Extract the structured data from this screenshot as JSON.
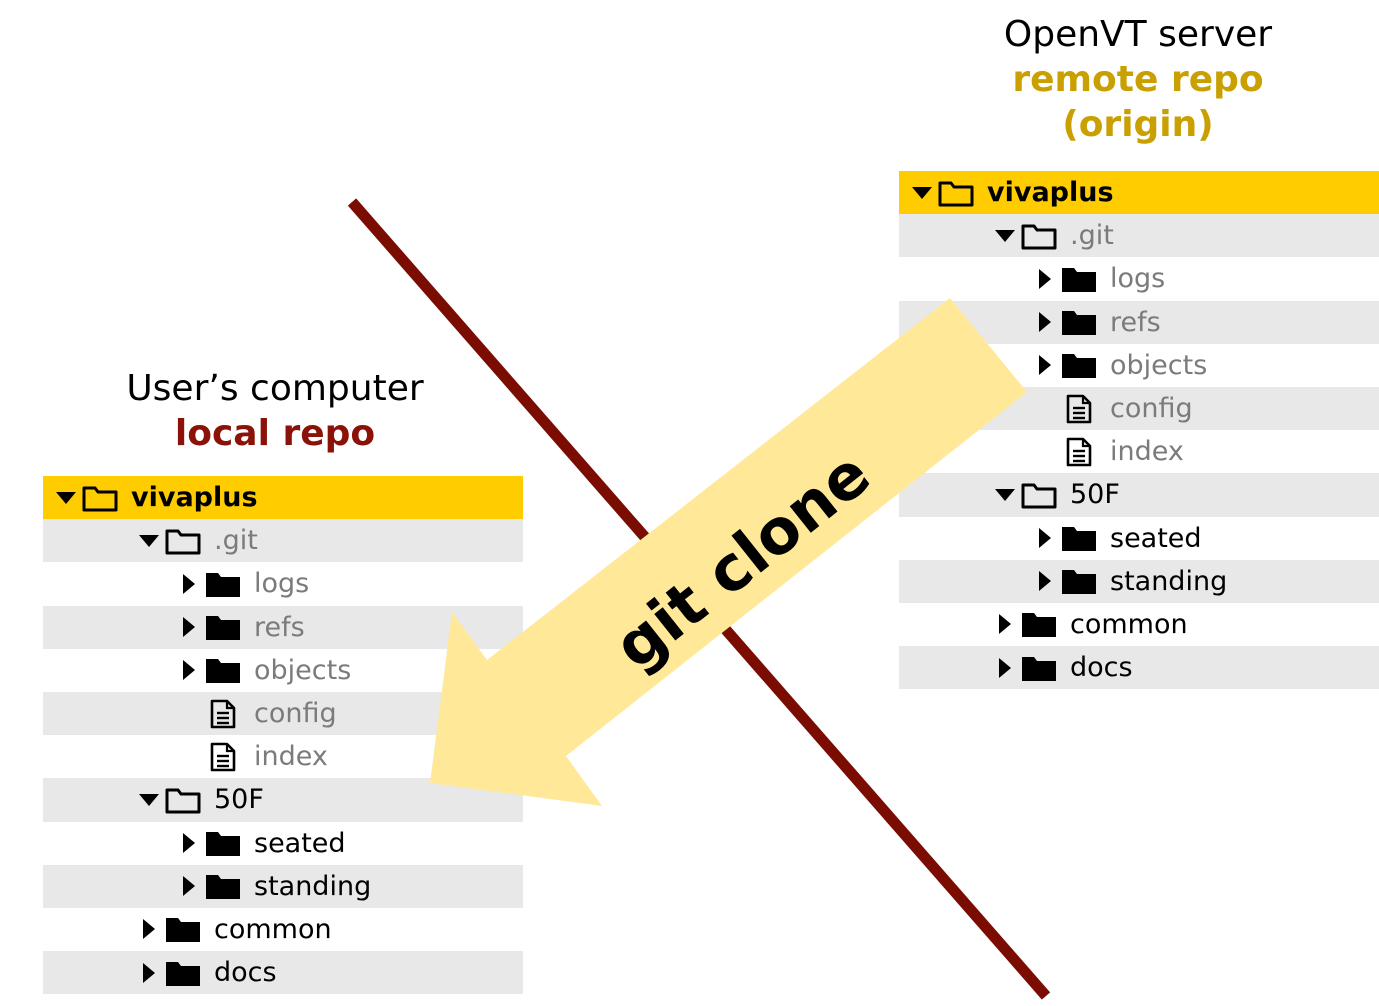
{
  "local": {
    "heading": "User’s computer",
    "subheading": "local repo",
    "subheading_color": "#8b1208",
    "tree": [
      {
        "label": "vivaplus",
        "depth": 0,
        "caret": "down",
        "icon": "folder-open-icon",
        "root": true
      },
      {
        "label": ".git",
        "depth": 1,
        "caret": "down",
        "icon": "folder-open-icon",
        "grey": true
      },
      {
        "label": "logs",
        "depth": 2,
        "caret": "right",
        "icon": "folder-icon",
        "grey": true
      },
      {
        "label": "refs",
        "depth": 2,
        "caret": "right",
        "icon": "folder-icon",
        "grey": true
      },
      {
        "label": "objects",
        "depth": 2,
        "caret": "right",
        "icon": "folder-icon",
        "grey": true
      },
      {
        "label": "config",
        "depth": 2,
        "caret": "none",
        "icon": "file-icon",
        "grey": true
      },
      {
        "label": "index",
        "depth": 2,
        "caret": "none",
        "icon": "file-icon",
        "grey": true
      },
      {
        "label": "50F",
        "depth": 1,
        "caret": "down",
        "icon": "folder-open-icon"
      },
      {
        "label": "seated",
        "depth": 2,
        "caret": "right",
        "icon": "folder-icon"
      },
      {
        "label": "standing",
        "depth": 2,
        "caret": "right",
        "icon": "folder-icon"
      },
      {
        "label": "common",
        "depth": 1,
        "caret": "right",
        "icon": "folder-icon"
      },
      {
        "label": "docs",
        "depth": 1,
        "caret": "right",
        "icon": "folder-icon"
      }
    ]
  },
  "remote": {
    "heading": "OpenVT server",
    "subheading": "remote repo",
    "subheading2": "(origin)",
    "subheading_color": "#c9a000",
    "tree": [
      {
        "label": "vivaplus",
        "depth": 0,
        "caret": "down",
        "icon": "folder-open-icon",
        "root": true
      },
      {
        "label": ".git",
        "depth": 1,
        "caret": "down",
        "icon": "folder-open-icon",
        "grey": true
      },
      {
        "label": "logs",
        "depth": 2,
        "caret": "right",
        "icon": "folder-icon",
        "grey": true
      },
      {
        "label": "refs",
        "depth": 2,
        "caret": "right",
        "icon": "folder-icon",
        "grey": true
      },
      {
        "label": "objects",
        "depth": 2,
        "caret": "right",
        "icon": "folder-icon",
        "grey": true
      },
      {
        "label": "config",
        "depth": 2,
        "caret": "none",
        "icon": "file-icon",
        "grey": true
      },
      {
        "label": "index",
        "depth": 2,
        "caret": "none",
        "icon": "file-icon",
        "grey": true
      },
      {
        "label": "50F",
        "depth": 1,
        "caret": "down",
        "icon": "folder-open-icon"
      },
      {
        "label": "seated",
        "depth": 2,
        "caret": "right",
        "icon": "folder-icon"
      },
      {
        "label": "standing",
        "depth": 2,
        "caret": "right",
        "icon": "folder-icon"
      },
      {
        "label": "common",
        "depth": 1,
        "caret": "right",
        "icon": "folder-icon"
      },
      {
        "label": "docs",
        "depth": 1,
        "caret": "right",
        "icon": "folder-icon"
      }
    ]
  },
  "arrow": {
    "label": "git clone",
    "fill_color": "#ffe999",
    "divider_color": "#7a0c02"
  },
  "colors": {
    "root_row": "#ffcc00",
    "shaded_row": "#e8e8e8",
    "grey_text": "#7b7b7b"
  }
}
